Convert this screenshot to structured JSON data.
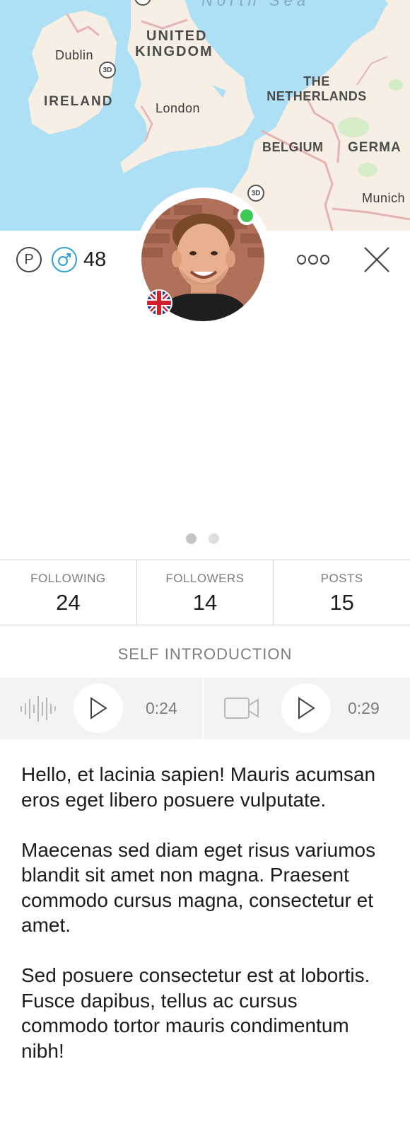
{
  "map": {
    "sea_label": "North Sea",
    "labels": {
      "united_kingdom": "UNITED\nKINGDOM",
      "united_kingdom_l1": "UNITED",
      "united_kingdom_l2": "KINGDOM",
      "ireland": "IRELAND",
      "dublin": "Dublin",
      "london": "London",
      "netherlands_l1": "THE",
      "netherlands_l2": "NETHERLANDS",
      "belgium": "BELGIUM",
      "germany": "GERMA",
      "munich": "Munich"
    },
    "badge_3d": "3D",
    "colors": {
      "water": "#aee0f5",
      "land": "#f7efe3",
      "border": "#e8b8b8",
      "park": "#d4ecc8"
    }
  },
  "profile": {
    "premium_icon": "P",
    "gender": "male",
    "age": "48",
    "online": true,
    "country_flag": "united-kingdom",
    "accent_gender_color": "#2f9fd8",
    "online_color": "#3bc953"
  },
  "photo_pager": {
    "count": 2,
    "active": 0
  },
  "stats": [
    {
      "label": "FOLLOWING",
      "value": "24"
    },
    {
      "label": "FOLLOWERS",
      "value": "14"
    },
    {
      "label": "POSTS",
      "value": "15"
    }
  ],
  "self_intro": {
    "title": "SELF INTRODUCTION",
    "audio_duration": "0:24",
    "video_duration": "0:29"
  },
  "bio": [
    "Hello, et lacinia sapien! Mauris acumsan eros eget libero posuere vulputate.",
    "Maecenas sed diam eget risus variumos blandit sit amet non magna. Praesent commodo cursus magna, consectetur et amet.",
    "Sed posuere consectetur est at lobortis. Fusce dapibus, tellus ac cursus commodo tortor mauris condimentum nibh!"
  ]
}
